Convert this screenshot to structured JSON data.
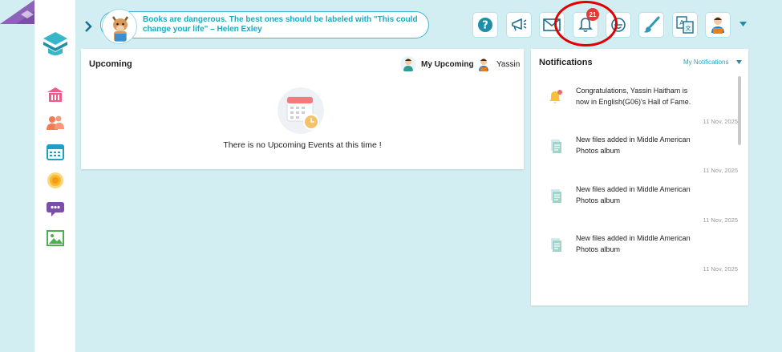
{
  "header": {
    "quote": "Books are dangerous. The best ones should be labeled with \"This could change your life\" – Helen Exley",
    "notification_count": "21"
  },
  "sidebar": {
    "items": [
      {
        "icon": "school-icon"
      },
      {
        "icon": "users-icon"
      },
      {
        "icon": "calendar-icon"
      },
      {
        "icon": "target-icon"
      },
      {
        "icon": "chat-icon"
      },
      {
        "icon": "image-icon"
      }
    ]
  },
  "toolbar": {
    "icons": [
      "help-icon",
      "megaphone-icon",
      "mail-icon",
      "bell-icon",
      "smile-icon",
      "paint-brush-icon",
      "translate-icon",
      "profile-icon"
    ]
  },
  "upcoming": {
    "title": "Upcoming",
    "filter_mine": "My Upcoming",
    "filter_user": "Yassin",
    "empty_message": "There is no Upcoming Events at this time !"
  },
  "notifications": {
    "title": "Notifications",
    "filter_label": "My Notifications",
    "items": [
      {
        "text": "Congratulations, Yassin Haitham is now in English(G06)'s Hall of Fame.",
        "date": "11 Nov, 2025",
        "icon": "bell-alert-icon"
      },
      {
        "text": "New files added in Middle American Photos album",
        "date": "11 Nov, 2025",
        "icon": "file-icon"
      },
      {
        "text": "New files added in Middle American Photos album",
        "date": "11 Nov, 2025",
        "icon": "file-icon"
      },
      {
        "text": "New files added in Middle American Photos album",
        "date": "11 Nov, 2025",
        "icon": "file-icon"
      }
    ]
  },
  "colors": {
    "background": "#d3eef2",
    "accent": "#1ea8c4",
    "sidebar_purple": "#7b4fa8",
    "badge": "#e53935",
    "highlight": "#e00000"
  }
}
